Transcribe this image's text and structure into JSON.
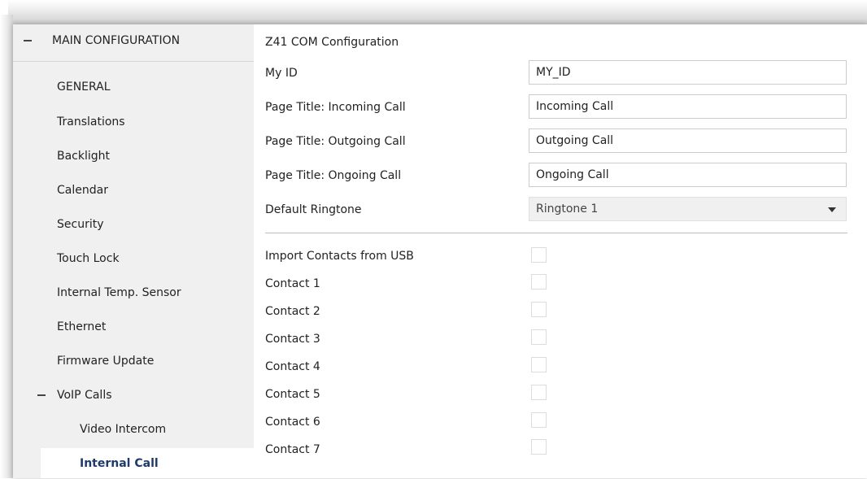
{
  "sidebar": {
    "main_config": "MAIN CONFIGURATION",
    "items": [
      {
        "label": "GENERAL"
      },
      {
        "label": "Translations"
      },
      {
        "label": "Backlight"
      },
      {
        "label": "Calendar"
      },
      {
        "label": "Security"
      },
      {
        "label": "Touch Lock"
      },
      {
        "label": "Internal Temp. Sensor"
      },
      {
        "label": "Ethernet"
      },
      {
        "label": "Firmware Update"
      }
    ],
    "voip_group": "VoIP Calls",
    "voip_items": [
      {
        "label": "Video Intercom"
      },
      {
        "label": "Internal Call"
      }
    ],
    "selected": "Internal Call"
  },
  "content": {
    "section_title": "Z41 COM Configuration",
    "fields": [
      {
        "label": "My ID",
        "value": "MY_ID"
      },
      {
        "label": "Page Title: Incoming Call",
        "value": "Incoming Call"
      },
      {
        "label": "Page Title: Outgoing Call",
        "value": "Outgoing Call"
      },
      {
        "label": "Page Title: Ongoing Call",
        "value": "Ongoing Call"
      }
    ],
    "ringtone": {
      "label": "Default Ringtone",
      "value": "Ringtone 1"
    },
    "checkboxes": [
      {
        "label": "Import Contacts from USB",
        "checked": false
      },
      {
        "label": "Contact 1",
        "checked": false
      },
      {
        "label": "Contact 2",
        "checked": false
      },
      {
        "label": "Contact 3",
        "checked": false
      },
      {
        "label": "Contact 4",
        "checked": false
      },
      {
        "label": "Contact 5",
        "checked": false
      },
      {
        "label": "Contact 6",
        "checked": false
      },
      {
        "label": "Contact 7",
        "checked": false
      }
    ]
  },
  "colors": {
    "sidebar_bg": "#f0f0f0",
    "selected_text": "#1e3a6b",
    "input_border": "#cccccc"
  }
}
